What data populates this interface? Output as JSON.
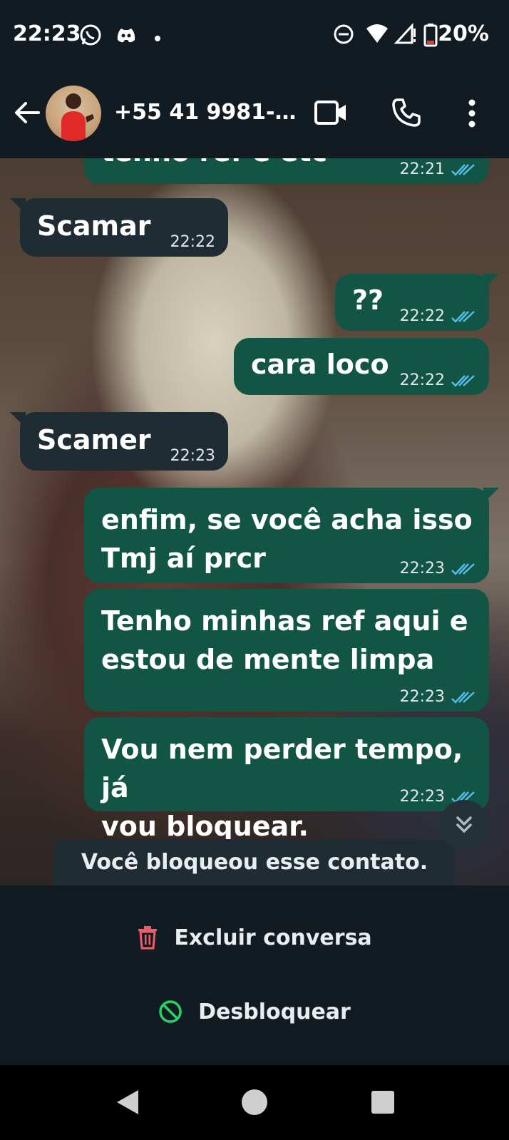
{
  "status_bar": {
    "time": "22:23",
    "battery": "20%",
    "icons": [
      "whatsapp-icon",
      "discord-icon",
      "notification-dot-icon",
      "do-not-disturb-icon",
      "wifi-icon",
      "signal-icon",
      "battery-icon"
    ]
  },
  "header": {
    "contact_name": "+55 41 9981-…",
    "icons": [
      "back-arrow-icon",
      "avatar",
      "video-call-icon",
      "voice-call-icon",
      "more-options-icon"
    ]
  },
  "messages": [
    {
      "direction": "out",
      "text": "tenho ref e etc",
      "time": "22:21",
      "ticks": "read"
    },
    {
      "direction": "in",
      "text": "Scamar",
      "time": "22:22"
    },
    {
      "direction": "out",
      "text": "??",
      "time": "22:22",
      "ticks": "read"
    },
    {
      "direction": "out",
      "text": "cara loco",
      "time": "22:22",
      "ticks": "read"
    },
    {
      "direction": "in",
      "text": "Scamer",
      "time": "22:23"
    },
    {
      "direction": "out",
      "text": "enfim, se você acha isso\nTmj aí prcr",
      "time": "22:23",
      "ticks": "read"
    },
    {
      "direction": "out",
      "text": "Tenho minhas ref aqui e\nestou de mente limpa",
      "time": "22:23",
      "ticks": "read"
    },
    {
      "direction": "out",
      "text": "Vou nem perder tempo, já\nvou bloquear.",
      "time": "22:23",
      "ticks": "read"
    }
  ],
  "blocked_notice": "Você bloqueou esse contato.",
  "actions": {
    "delete_label": "Excluir conversa",
    "unblock_label": "Desbloquear"
  },
  "colors": {
    "header_bg": "#111b21",
    "incoming_bubble": "#202c33",
    "outgoing_bubble": "#125544",
    "read_ticks": "#53bdeb",
    "delete_icon": "#f15c6d",
    "unblock_icon": "#25d366"
  }
}
